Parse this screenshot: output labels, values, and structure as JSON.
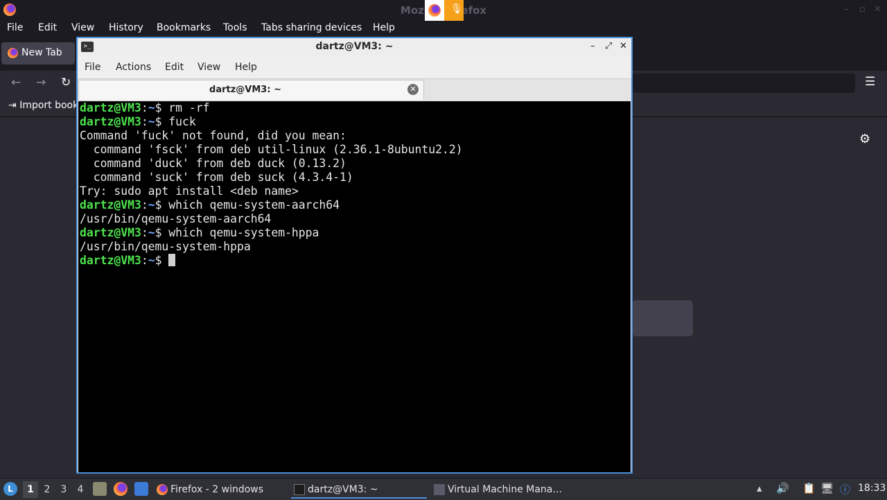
{
  "firefox": {
    "window_title": "Mozilla Firefox",
    "menu": [
      "File",
      "Edit",
      "View",
      "History",
      "Bookmarks",
      "Tools",
      "Tabs sharing devices",
      "Help"
    ],
    "tab_label": "New Tab",
    "bookmarks_item": "Import bookmarks…",
    "icons": {
      "logo": "firefox-logo-icon",
      "back": "back-arrow-icon",
      "forward": "forward-arrow-icon",
      "reload": "reload-icon",
      "menu": "hamburger-menu-icon",
      "settings": "gear-icon",
      "mic": "microphone-icon"
    }
  },
  "terminal": {
    "window_title": "dartz@VM3: ~",
    "menu": [
      "File",
      "Actions",
      "Edit",
      "View",
      "Help"
    ],
    "tab_label": "dartz@VM3: ~",
    "prompt": {
      "user": "dartz@VM3",
      "sep": ":",
      "path": "~",
      "symbol": "$"
    },
    "lines": [
      {
        "type": "prompt",
        "cmd": " rm -rf"
      },
      {
        "type": "prompt",
        "cmd": " fuck"
      },
      {
        "type": "output",
        "text": "Command 'fuck' not found, did you mean:"
      },
      {
        "type": "output",
        "text": "  command 'fsck' from deb util-linux (2.36.1-8ubuntu2.2)"
      },
      {
        "type": "output",
        "text": "  command 'duck' from deb duck (0.13.2)"
      },
      {
        "type": "output",
        "text": "  command 'suck' from deb suck (4.3.4-1)"
      },
      {
        "type": "output",
        "text": "Try: sudo apt install <deb name>"
      },
      {
        "type": "prompt",
        "cmd": " which qemu-system-aarch64"
      },
      {
        "type": "output",
        "text": "/usr/bin/qemu-system-aarch64"
      },
      {
        "type": "prompt",
        "cmd": " which qemu-system-hppa"
      },
      {
        "type": "output",
        "text": "/usr/bin/qemu-system-hppa"
      },
      {
        "type": "prompt",
        "cmd": " ",
        "cursor": true
      }
    ],
    "colors": {
      "user": "#4ee34e",
      "path": "#6fa8ff",
      "background": "#000000",
      "border": "#4a90d9"
    }
  },
  "taskbar": {
    "workspaces": [
      "1",
      "2",
      "3",
      "4"
    ],
    "active_workspace": "1",
    "tasks": [
      {
        "label": "Firefox - 2 windows",
        "icon": "firefox-icon"
      },
      {
        "label": "dartz@VM3: ~",
        "icon": "terminal-icon",
        "active": true
      },
      {
        "label": "Virtual Machine Mana…",
        "icon": "virt-manager-icon"
      }
    ],
    "clock": "18:33",
    "tray_icons": [
      "tray-up-arrow-icon",
      "volume-icon",
      "clipboard-icon",
      "network-icon",
      "notification-icon"
    ]
  }
}
